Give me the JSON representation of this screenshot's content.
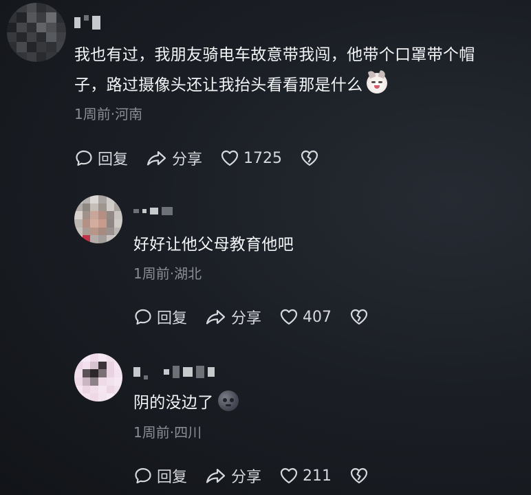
{
  "colors": {
    "text_primary": "#f4f5f6",
    "text_secondary": "#8a8d93",
    "action_text": "#d6d8db"
  },
  "icons": {
    "reply": "speech-bubble-icon",
    "share": "share-arrow-icon",
    "like": "heart-icon",
    "dislike": "broken-heart-icon"
  },
  "comments": [
    {
      "text_line1": "我也有过，我朋友骑电车故意带我闯，他带个口罩带个帽",
      "text_line2": "子，路过摄像头还让我抬头看看那是什么",
      "emoji": "cat-face-emoji",
      "meta": "1周前·河南",
      "reply_label": "回复",
      "share_label": "分享",
      "likes": "1725"
    },
    {
      "text_line1": "好好让他父母教育他吧",
      "meta": "1周前·湖北",
      "reply_label": "回复",
      "share_label": "分享",
      "likes": "407"
    },
    {
      "text_line1": "阴的没边了",
      "emoji": "new-moon-face-emoji",
      "meta": "1周前·四川",
      "reply_label": "回复",
      "share_label": "分享",
      "likes": "211"
    }
  ]
}
